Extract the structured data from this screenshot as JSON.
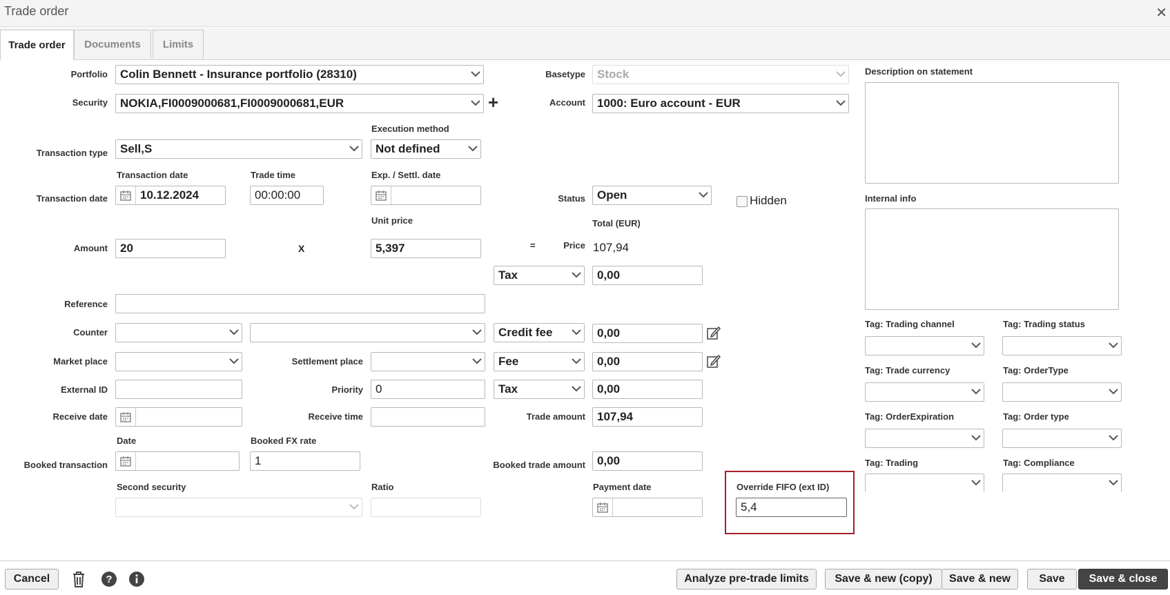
{
  "window": {
    "title": "Trade order"
  },
  "tabs": [
    {
      "label": "Trade order"
    },
    {
      "label": "Documents"
    },
    {
      "label": "Limits"
    }
  ],
  "form": {
    "portfolio": {
      "label": "Portfolio",
      "value": "Colin Bennett - Insurance portfolio (28310)"
    },
    "security": {
      "label": "Security",
      "value": "NOKIA,FI0009000681,FI0009000681,EUR",
      "add_symbol": "+"
    },
    "basetype": {
      "label": "Basetype",
      "value": "Stock"
    },
    "account": {
      "label": "Account",
      "value": "1000: Euro account - EUR"
    },
    "execution_method": {
      "label": "Execution method",
      "value": "Not defined"
    },
    "transaction_type": {
      "label": "Transaction type",
      "value": "Sell,S"
    },
    "transaction_date_row": {
      "label": "Transaction date",
      "date_label": "Transaction date",
      "date_value": "10.12.2024",
      "time_label": "Trade time",
      "time_value": "00:00:00",
      "settl_label": "Exp. / Settl. date",
      "settl_value": ""
    },
    "status": {
      "label": "Status",
      "value": "Open"
    },
    "hidden": {
      "label": "Hidden",
      "checked": false
    },
    "amount": {
      "label": "Amount",
      "value": "20",
      "times": "X"
    },
    "unit_price": {
      "label": "Unit price",
      "value": "5,397"
    },
    "equals": "=",
    "price": {
      "label": "Price",
      "total_label": "Total (EUR)",
      "value": "107,94"
    },
    "tax1": {
      "type": "Tax",
      "value": "0,00"
    },
    "reference": {
      "label": "Reference",
      "value": ""
    },
    "counter": {
      "label": "Counter",
      "value1": "",
      "value2": ""
    },
    "credit_fee": {
      "type": "Credit fee",
      "value": "0,00"
    },
    "market_place": {
      "label": "Market place",
      "value": ""
    },
    "settlement_place": {
      "label": "Settlement place",
      "value": ""
    },
    "fee": {
      "type": "Fee",
      "value": "0,00"
    },
    "external_id": {
      "label": "External ID",
      "value": ""
    },
    "priority": {
      "label": "Priority",
      "value": "0"
    },
    "tax2": {
      "type": "Tax",
      "value": "0,00"
    },
    "receive_date": {
      "label": "Receive date",
      "value": ""
    },
    "receive_time": {
      "label": "Receive time",
      "value": ""
    },
    "trade_amount": {
      "label": "Trade amount",
      "value": "107,94"
    },
    "booked": {
      "label": "Booked transaction",
      "date_label": "Date",
      "date_value": "",
      "fx_label": "Booked FX rate",
      "fx_value": "1",
      "trade_amount_label": "Booked trade amount",
      "trade_amount_value": "0,00"
    },
    "second_security": {
      "label": "Second security",
      "value": ""
    },
    "ratio": {
      "label": "Ratio",
      "value": ""
    },
    "payment_date": {
      "label": "Payment date",
      "value": ""
    },
    "override_fifo": {
      "label": "Override FIFO (ext ID)",
      "value": "5,4"
    }
  },
  "side": {
    "description_label": "Description on statement",
    "internal_info_label": "Internal info",
    "tags": [
      {
        "label": "Tag: Trading channel"
      },
      {
        "label": "Tag: Trading status"
      },
      {
        "label": "Tag: Trade currency"
      },
      {
        "label": "Tag: OrderType"
      },
      {
        "label": "Tag: OrderExpiration"
      },
      {
        "label": "Tag: Order type"
      },
      {
        "label": "Tag: Trading"
      },
      {
        "label": "Tag: Compliance"
      }
    ]
  },
  "footer": {
    "cancel": "Cancel",
    "analyze": "Analyze pre-trade limits",
    "save_new_copy": "Save & new (copy)",
    "save_new": "Save & new",
    "save": "Save",
    "save_close": "Save & close"
  },
  "colors": {
    "highlight": "#a32027",
    "primary_button": "#444444"
  }
}
